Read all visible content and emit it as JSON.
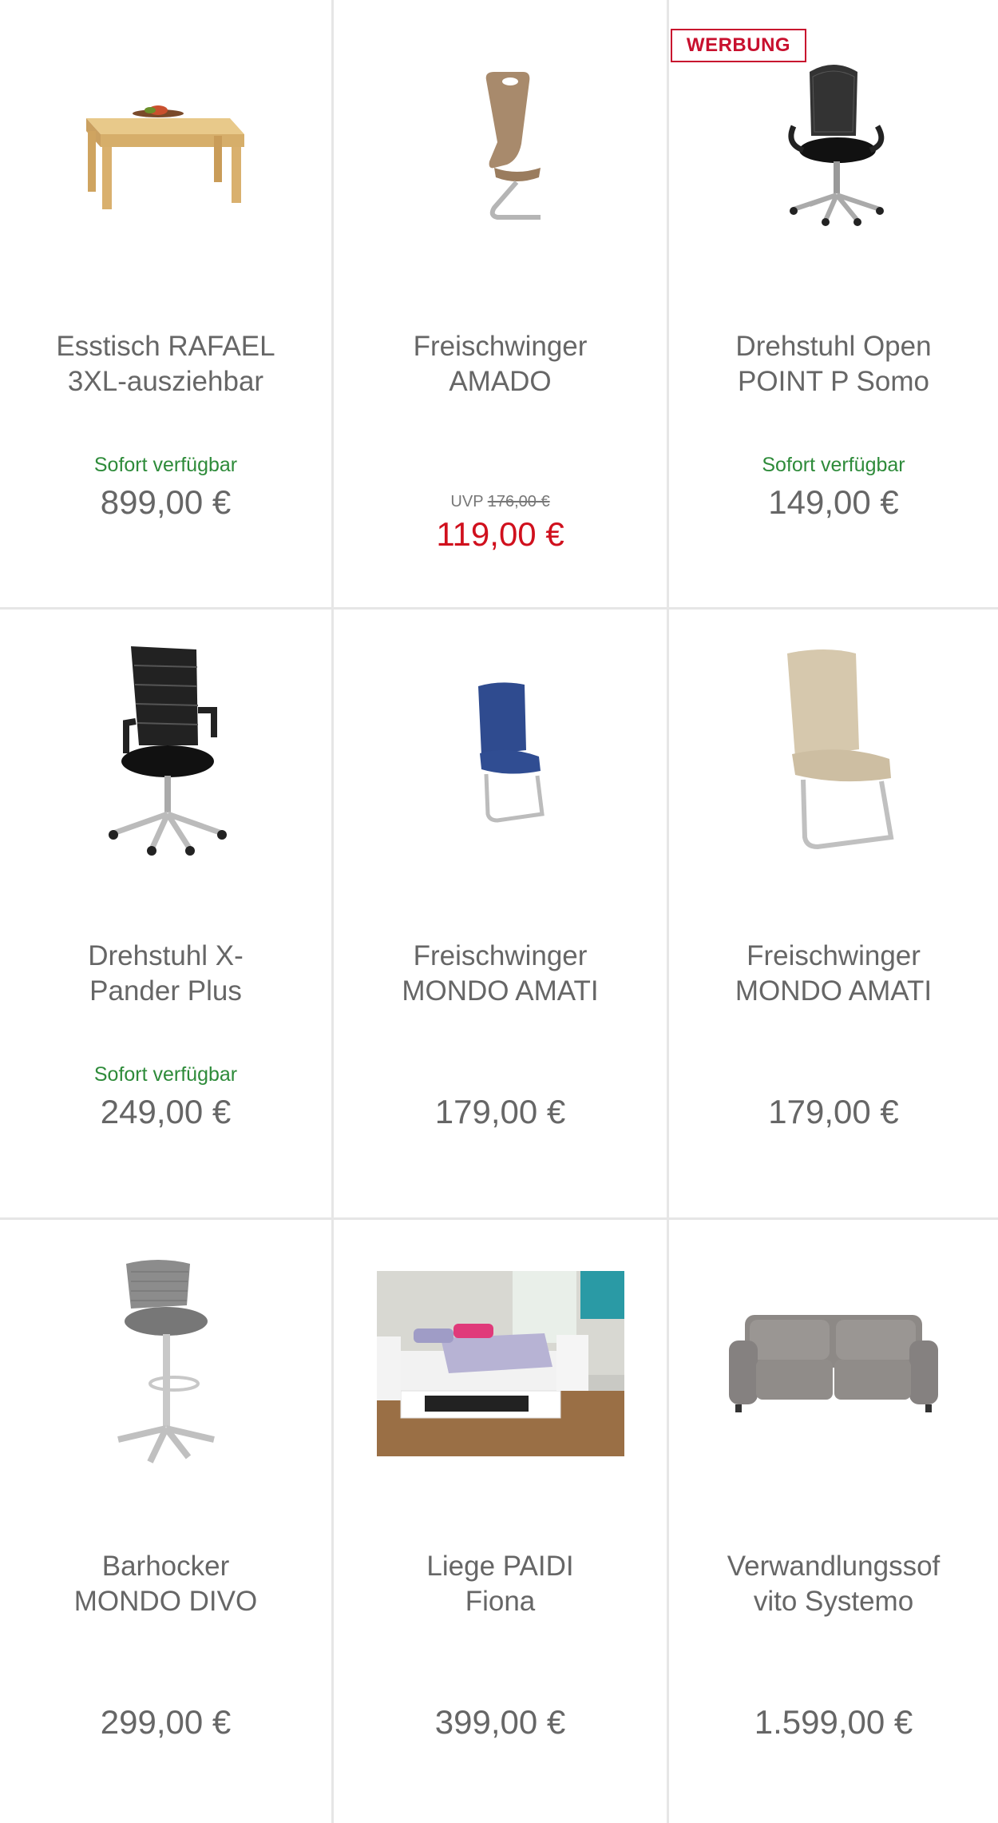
{
  "badge_label": "WERBUNG",
  "colors": {
    "available": "#2e8b3a",
    "sale": "#d0101d",
    "badge": "#c8102e",
    "divider": "#e6e6e6"
  },
  "products": [
    {
      "title_line1": "Esstisch RAFAEL",
      "title_line2": "3XL-ausziehbar",
      "availability": "Sofort verfügbar",
      "price": "899,00 €",
      "icon": "dining-table"
    },
    {
      "title_line1": "Freischwinger",
      "title_line2": "AMADO",
      "uvp_label": "UVP",
      "uvp_old_price": "176,00 €",
      "price": "119,00 €",
      "icon": "cantilever-chair-brown"
    },
    {
      "title_line1": "Drehstuhl Open",
      "title_line2": "POINT P Somo",
      "availability": "Sofort verfügbar",
      "price": "149,00 €",
      "icon": "office-chair"
    },
    {
      "title_line1": "Drehstuhl X-",
      "title_line2": "Pander Plus",
      "availability": "Sofort verfügbar",
      "price": "249,00 €",
      "icon": "office-chair-highback"
    },
    {
      "title_line1": "Freischwinger",
      "title_line2": "MONDO AMATI",
      "price": "179,00 €",
      "icon": "cantilever-chair-blue"
    },
    {
      "title_line1": "Freischwinger",
      "title_line2": "MONDO AMATI",
      "price": "179,00 €",
      "icon": "cantilever-chair-beige"
    },
    {
      "title_line1": "Barhocker",
      "title_line2": "MONDO DIVO",
      "price": "299,00 €",
      "icon": "bar-stool"
    },
    {
      "title_line1": "Liege PAIDI",
      "title_line2": "Fiona",
      "price": "399,00 €",
      "icon": "bed-room-photo"
    },
    {
      "title_line1": "Verwandlungssof",
      "title_line2": "vito Systemo",
      "price": "1.599,00 €",
      "icon": "sofa"
    }
  ]
}
